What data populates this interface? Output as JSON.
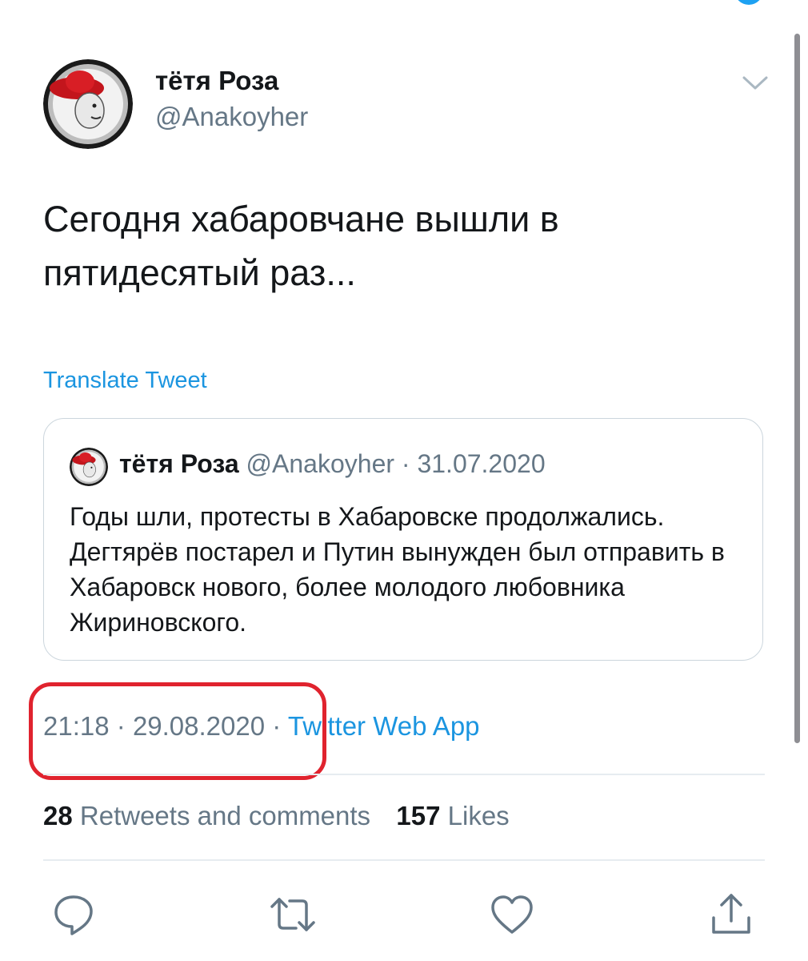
{
  "tweet": {
    "author_name": "тётя Роза",
    "author_handle": "@Anakoyher",
    "text": "Сегодня хабаровчане вышли в пятидесятый раз...",
    "translate_label": "Translate Tweet",
    "time": "21:18",
    "date": "29.08.2020",
    "separator": "·",
    "source": "Twitter Web App"
  },
  "quoted_tweet": {
    "author_name": "тётя Роза",
    "author_handle": "@Anakoyher",
    "separator": "·",
    "date": "31.07.2020",
    "text": "Годы шли, протесты в Хабаровске продолжались. Дегтярёв постарел и Путин вынужден был отправить в Хабаровск нового, более молодого любовника Жириновского."
  },
  "stats": {
    "retweets_count": "28",
    "retweets_label": "Retweets and comments",
    "likes_count": "157",
    "likes_label": "Likes"
  },
  "icons": {
    "more": "chevron-down-icon",
    "reply": "reply-icon",
    "retweet": "retweet-icon",
    "like": "heart-icon",
    "share": "share-icon"
  },
  "colors": {
    "link": "#1b95e0",
    "secondary_text": "#657786",
    "annotation_box": "#e0232e",
    "border": "#ccd6dd"
  }
}
